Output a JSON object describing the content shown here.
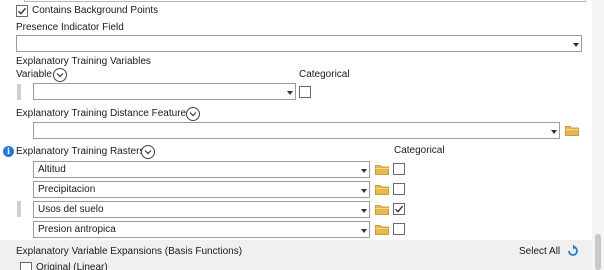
{
  "background_points": {
    "label": "Contains Background Points",
    "checked": true
  },
  "presence_field": {
    "label": "Presence Indicator Field",
    "value": ""
  },
  "variables": {
    "section_label": "Explanatory Training Variables",
    "column_label": "Variable",
    "categorical_label": "Categorical",
    "rows": [
      {
        "value": "",
        "categorical": false
      }
    ]
  },
  "distance_features": {
    "label": "Explanatory Training Distance Features",
    "value": ""
  },
  "rasters": {
    "label": "Explanatory Training Rasters",
    "categorical_label": "Categorical",
    "rows": [
      {
        "value": "Altitud",
        "categorical": false
      },
      {
        "value": "Precipitacion",
        "categorical": false
      },
      {
        "value": "Usos del suelo",
        "categorical": true
      },
      {
        "value": "Presion antropica",
        "categorical": false
      }
    ]
  },
  "expansions": {
    "label": "Explanatory Variable Expansions (Basis Functions)",
    "select_all_label": "Select All",
    "options": [
      {
        "label": "Original (Linear)",
        "checked": false
      }
    ]
  },
  "icons": {
    "info": "info-icon",
    "reset": "reset-icon",
    "folder": "folder-icon",
    "chevron": "chevron-down-icon",
    "check": "checkmark-icon"
  },
  "colors": {
    "accent": "#1f7ad0",
    "folder": "#e8b84a"
  }
}
